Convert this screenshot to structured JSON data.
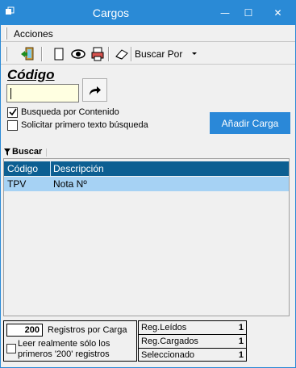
{
  "window": {
    "title": "Cargos",
    "controls": {
      "minimize": "—",
      "maximize": "☐",
      "close": "✕"
    },
    "accent": "#2a8ad6"
  },
  "menu": {
    "acciones": "Acciones"
  },
  "toolbar": {
    "icons": [
      "exit-door-icon",
      "new-document-icon",
      "view-eye-icon",
      "print-icon",
      "eraser-icon"
    ],
    "buscar_por": "Buscar Por"
  },
  "codigo": {
    "label": "Código",
    "value": ""
  },
  "options": {
    "busqueda_contenido": {
      "label": "Busqueda por Contenido",
      "checked": true
    },
    "solicitar_texto": {
      "label": "Solicitar primero texto búsqueda",
      "checked": false
    }
  },
  "add_button": {
    "label": "Añadir Carga",
    "color": "#2a88d8"
  },
  "buscar": {
    "label": "Buscar"
  },
  "grid": {
    "columns": [
      "Código",
      "Descripción"
    ],
    "rows": [
      {
        "codigo": "TPV",
        "descripcion": "Nota Nº"
      }
    ],
    "header_color": "#0d5f92",
    "selected_color": "#a6d2f4"
  },
  "footer": {
    "registros_count": "200",
    "registros_label": "Registros por Carga",
    "leer_label": "Leer realmente sólo los primeros '200' registros",
    "stats": [
      {
        "label": "Reg.Leídos",
        "value": "1"
      },
      {
        "label": "Reg.Cargados",
        "value": "1"
      },
      {
        "label": "Seleccionado",
        "value": "1"
      }
    ]
  }
}
